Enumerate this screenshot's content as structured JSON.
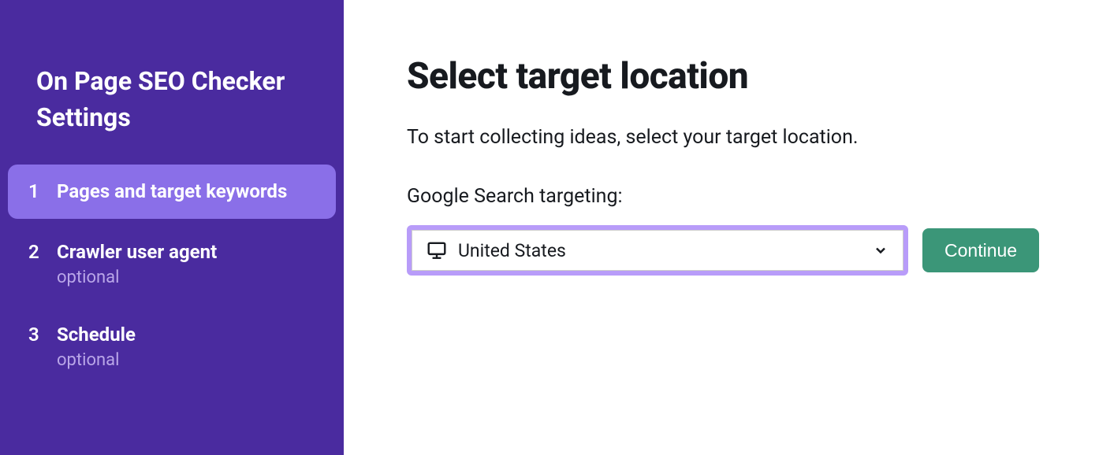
{
  "sidebar": {
    "title": "On Page SEO Checker Settings",
    "steps": [
      {
        "number": "1",
        "label": "Pages and target keywords",
        "sub": ""
      },
      {
        "number": "2",
        "label": "Crawler user agent",
        "sub": "optional"
      },
      {
        "number": "3",
        "label": "Schedule",
        "sub": "optional"
      }
    ]
  },
  "main": {
    "title": "Select target location",
    "description": "To start collecting ideas, select your target location.",
    "section_label": "Google Search targeting:",
    "select_value": "United States",
    "continue_label": "Continue"
  }
}
